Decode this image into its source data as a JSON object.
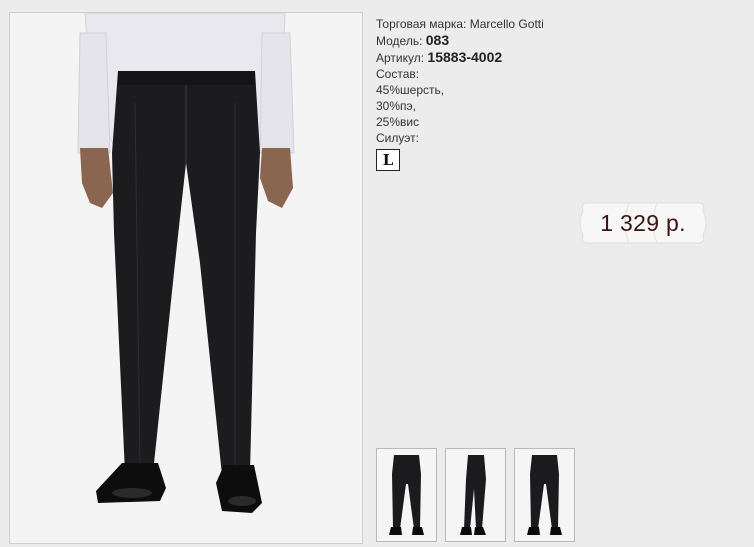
{
  "product": {
    "brand_label": "Торговая марка:",
    "brand_value": "Marcello Gotti",
    "model_label": "Модель:",
    "model_value": "083",
    "article_label": "Артикул:",
    "article_value": "15883-4002",
    "composition_label": "Состав:",
    "composition_items": [
      "45%шерсть,",
      "30%пэ,",
      "25%вис"
    ],
    "silhouette_label": "Силуэт:",
    "silhouette_value": "L"
  },
  "price": {
    "text": "1 329 р."
  },
  "thumbnails": [
    {
      "name": "thumb-front"
    },
    {
      "name": "thumb-side"
    },
    {
      "name": "thumb-back"
    }
  ]
}
